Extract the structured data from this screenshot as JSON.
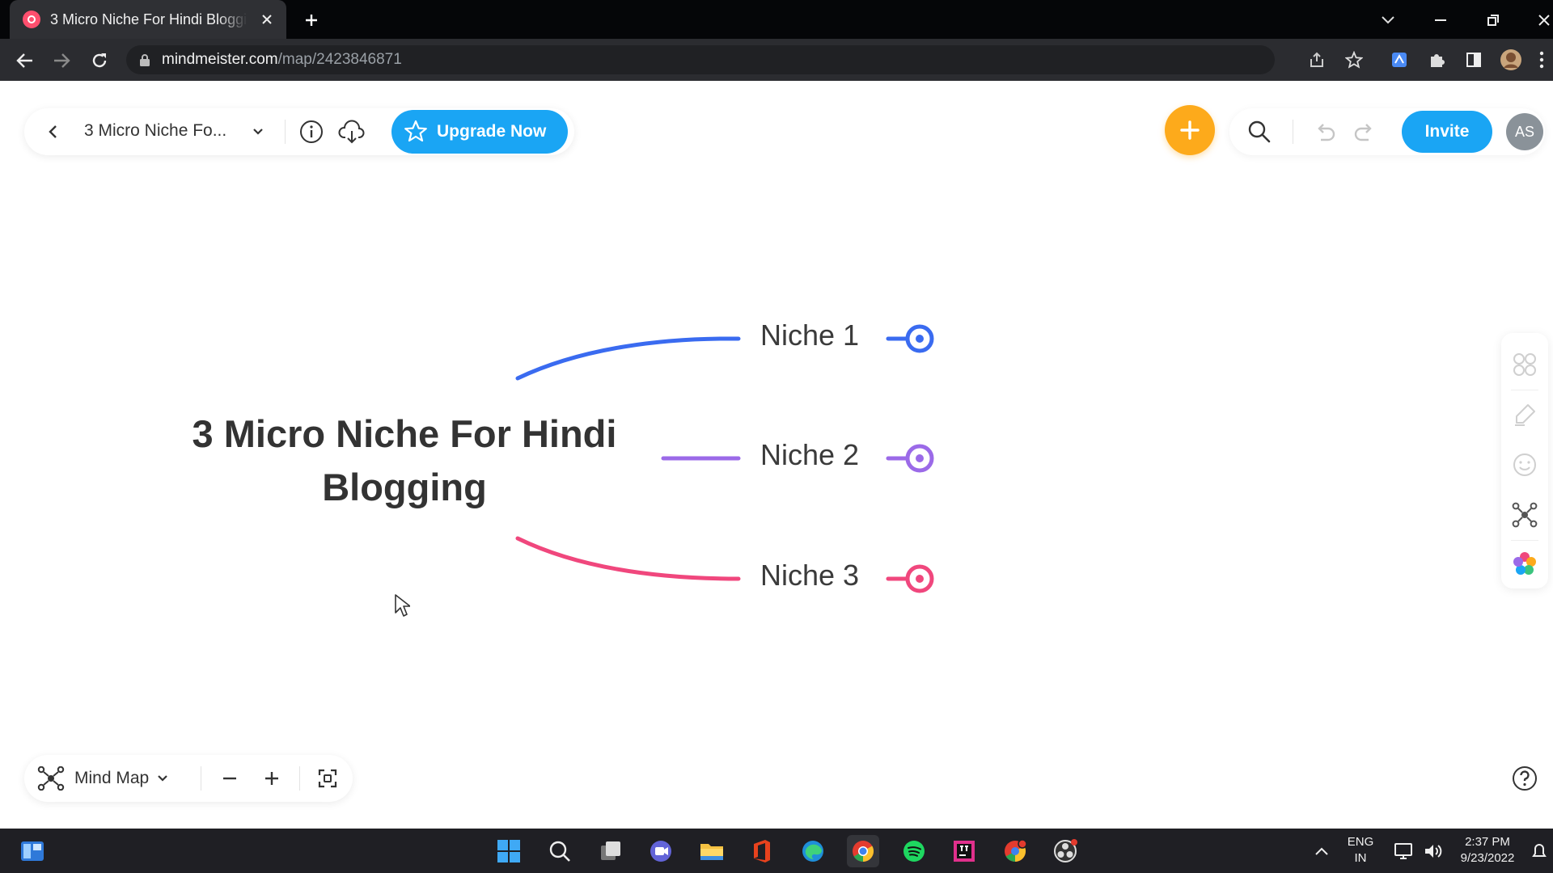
{
  "browser": {
    "tab_title": "3 Micro Niche For Hindi Blogging",
    "url_host": "mindmeister.com",
    "url_path": "/map/2423846871",
    "icons": [
      "back-arrow-icon",
      "forward-arrow-icon",
      "reload-icon",
      "lock-icon",
      "share-icon",
      "star-icon",
      "extension-icon",
      "puzzle-icon",
      "sidebar-icon",
      "profile-icon",
      "menu-icon"
    ]
  },
  "toolbar": {
    "map_title": "3 Micro Niche Fo...",
    "upgrade_label": "Upgrade Now",
    "invite_label": "Invite",
    "avatar_initials": "AS"
  },
  "mindmap": {
    "root": "3 Micro Niche For Hindi Blogging",
    "root_line1": "3 Micro Niche For Hindi",
    "root_line2": "Blogging",
    "children": [
      {
        "label": "Niche 1",
        "color": "#3a6bf0"
      },
      {
        "label": "Niche 2",
        "color": "#9b6ae8"
      },
      {
        "label": "Niche 3",
        "color": "#f0477d"
      }
    ]
  },
  "bottom_bar": {
    "mode_label": "Mind Map"
  },
  "colors": {
    "accent_blue": "#1aa5f4",
    "add_orange": "#fdaa1b"
  },
  "taskbar": {
    "language_line1": "ENG",
    "language_line2": "IN",
    "time": "2:37 PM",
    "date": "9/23/2022"
  }
}
